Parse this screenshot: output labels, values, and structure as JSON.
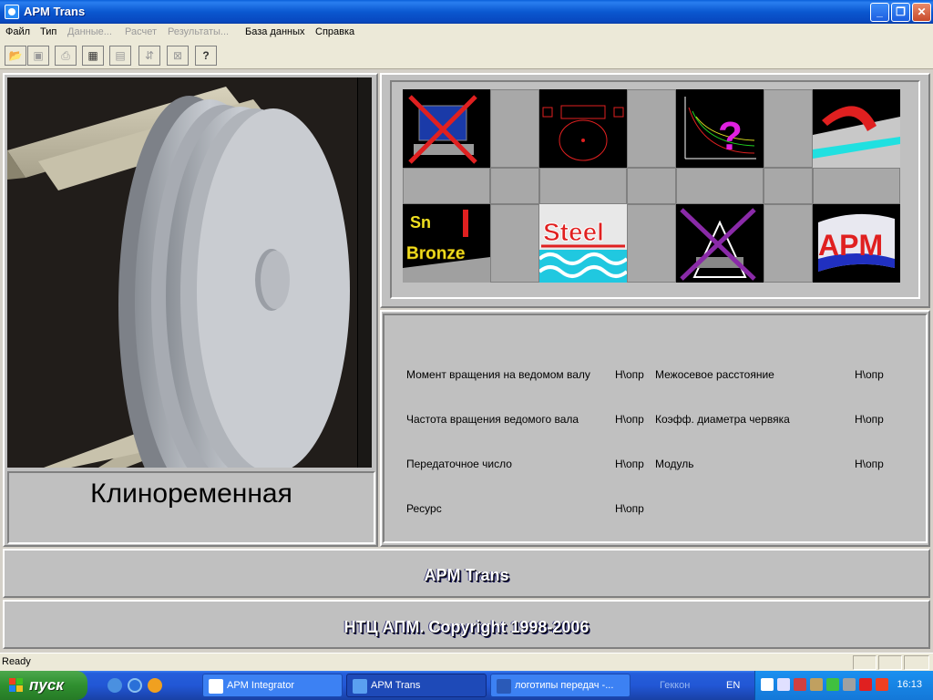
{
  "window": {
    "title": "APM Trans",
    "minimize": "_",
    "maximize": "❐",
    "close": "✕"
  },
  "menu": [
    {
      "label": "Файл",
      "enabled": true
    },
    {
      "label": "Тип",
      "enabled": true
    },
    {
      "label": "Данные...",
      "enabled": false
    },
    {
      "label": "Расчет",
      "enabled": false
    },
    {
      "label": "Результаты...",
      "enabled": false
    },
    {
      "label": "База данных",
      "enabled": true
    },
    {
      "label": "Справка",
      "enabled": true
    }
  ],
  "toolbar": [
    {
      "icon": "open-folder-icon",
      "glyph": "📂",
      "enabled": true
    },
    {
      "icon": "save-icon",
      "glyph": "▣",
      "enabled": false
    },
    {
      "icon": "print-icon",
      "glyph": "⎙",
      "enabled": false
    },
    {
      "icon": "data-icon",
      "glyph": "▦",
      "enabled": true
    },
    {
      "icon": "table-icon",
      "glyph": "▤",
      "enabled": false
    },
    {
      "icon": "calc-icon",
      "glyph": "⇵",
      "enabled": false
    },
    {
      "icon": "chart-icon",
      "glyph": "⊠",
      "enabled": false
    },
    {
      "icon": "help-icon",
      "glyph": "?",
      "enabled": true
    }
  ],
  "transmission_name": "Клиноременная",
  "icon_tiles": [
    {
      "name": "computer-crossed-icon"
    },
    {
      "name": "gear-drawing-icon"
    },
    {
      "name": "graph-question-icon"
    },
    {
      "name": "belt-icon"
    },
    {
      "name": "sn-bronze-icon",
      "text1": "Sn",
      "text2": "Bronze"
    },
    {
      "name": "steel-icon",
      "text": "Steel"
    },
    {
      "name": "tolerance-crossed-icon"
    },
    {
      "name": "apm-logo-icon",
      "text": "APM"
    }
  ],
  "params": [
    {
      "label": "Момент вращения на ведомом валу",
      "value": "Н\\опр"
    },
    {
      "label": "Частота вращения ведомого вала",
      "value": "Н\\опр"
    },
    {
      "label": "Передаточное число",
      "value": "Н\\опр"
    },
    {
      "label": "Ресурс",
      "value": "Н\\опр"
    },
    {
      "label": "Межосевое расстояние",
      "value": "Н\\опр"
    },
    {
      "label": "Коэфф. диаметра червяка",
      "value": "Н\\опр"
    },
    {
      "label": "Модуль",
      "value": "Н\\опр"
    }
  ],
  "banner_title": "APM Trans",
  "banner_copyright": "НТЦ АПМ. Copyright 1998-2006",
  "status_text": "Ready",
  "taskbar": {
    "start": "пуск",
    "tasks": [
      {
        "label": "APM Integrator",
        "active": false
      },
      {
        "label": "APM Trans",
        "active": true
      },
      {
        "label": "логотипы передач -...",
        "active": false
      }
    ],
    "extra": "Геккон",
    "lang": "EN",
    "clock": "16:13"
  }
}
